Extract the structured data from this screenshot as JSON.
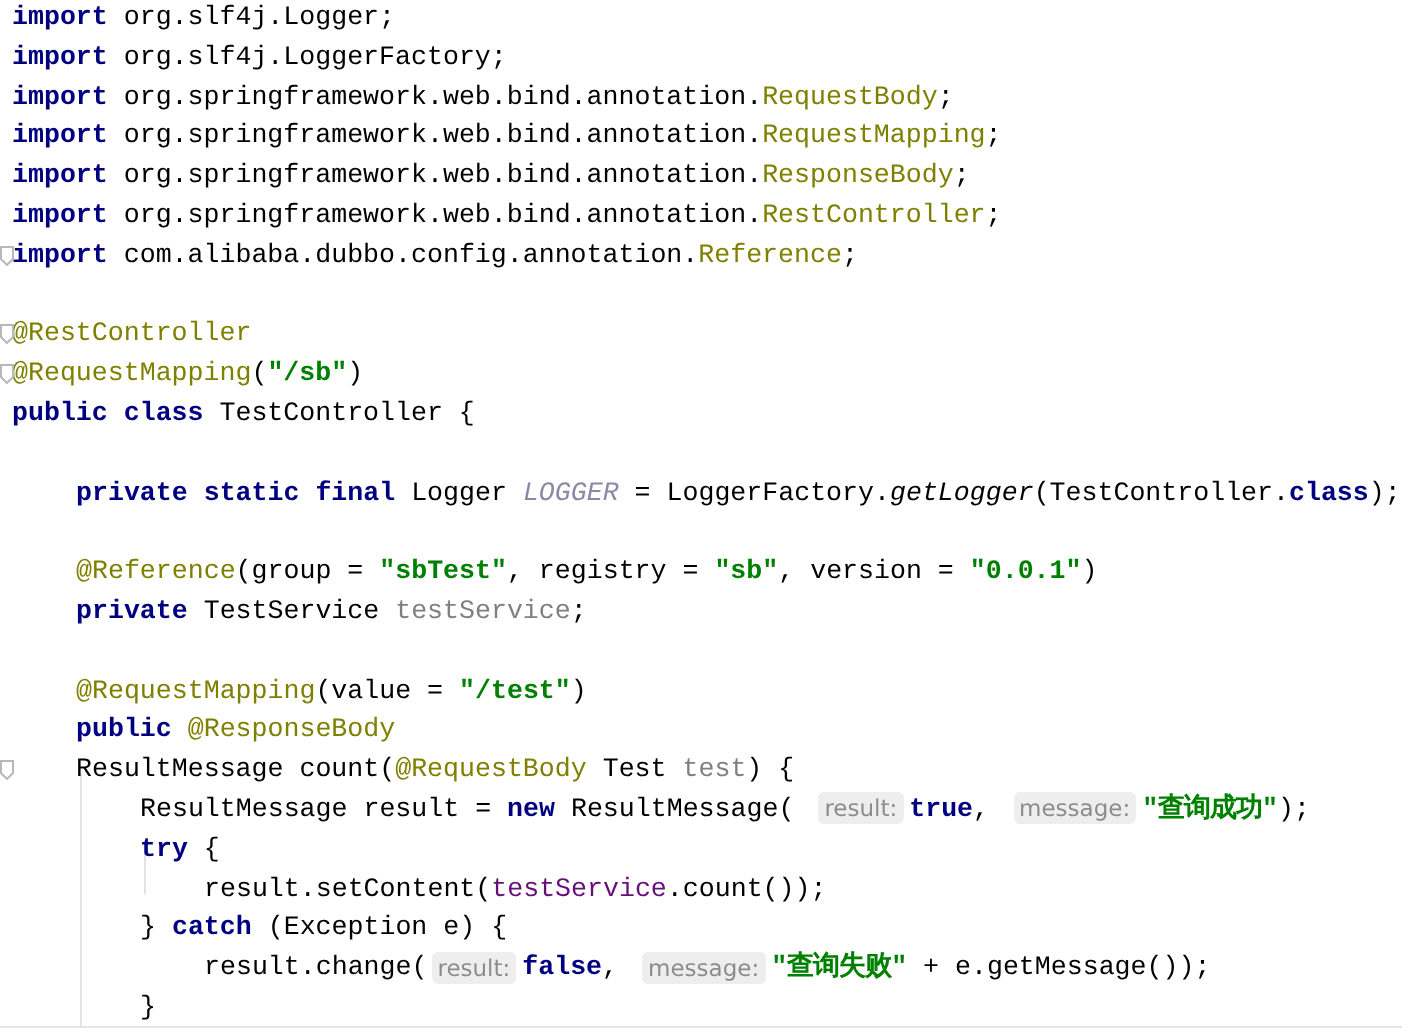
{
  "editor": {
    "lines": [
      {
        "kind": "code",
        "tokens": [
          {
            "kind": "keyword",
            "text": "import"
          },
          {
            "kind": "plain",
            "text": " org.slf4j.Logger;"
          }
        ]
      },
      {
        "kind": "code",
        "tokens": [
          {
            "kind": "keyword",
            "text": "import"
          },
          {
            "kind": "plain",
            "text": " org.slf4j.LoggerFactory;"
          }
        ]
      },
      {
        "kind": "code",
        "tokens": [
          {
            "kind": "keyword",
            "text": "import"
          },
          {
            "kind": "plain",
            "text": " org.springframework.web.bind.annotation."
          },
          {
            "kind": "annotation",
            "text": "RequestBody"
          },
          {
            "kind": "plain",
            "text": ";"
          }
        ]
      },
      {
        "kind": "code",
        "tokens": [
          {
            "kind": "keyword",
            "text": "import"
          },
          {
            "kind": "plain",
            "text": " org.springframework.web.bind.annotation."
          },
          {
            "kind": "annotation",
            "text": "RequestMapping"
          },
          {
            "kind": "plain",
            "text": ";"
          }
        ]
      },
      {
        "kind": "code",
        "tokens": [
          {
            "kind": "keyword",
            "text": "import"
          },
          {
            "kind": "plain",
            "text": " org.springframework.web.bind.annotation."
          },
          {
            "kind": "annotation",
            "text": "ResponseBody"
          },
          {
            "kind": "plain",
            "text": ";"
          }
        ]
      },
      {
        "kind": "code",
        "tokens": [
          {
            "kind": "keyword",
            "text": "import"
          },
          {
            "kind": "plain",
            "text": " org.springframework.web.bind.annotation."
          },
          {
            "kind": "annotation",
            "text": "RestController"
          },
          {
            "kind": "plain",
            "text": ";"
          }
        ]
      },
      {
        "kind": "code",
        "fold": true,
        "tokens": [
          {
            "kind": "keyword",
            "text": "import"
          },
          {
            "kind": "plain",
            "text": " com.alibaba.dubbo.config.annotation."
          },
          {
            "kind": "annotation",
            "text": "Reference"
          },
          {
            "kind": "plain",
            "text": ";"
          }
        ]
      },
      {
        "kind": "blank"
      },
      {
        "kind": "code",
        "fold": true,
        "tokens": [
          {
            "kind": "annotation",
            "text": "@RestController"
          }
        ]
      },
      {
        "kind": "code",
        "fold": true,
        "tokens": [
          {
            "kind": "annotation",
            "text": "@RequestMapping"
          },
          {
            "kind": "plain",
            "text": "("
          },
          {
            "kind": "string",
            "text": "\"/sb\""
          },
          {
            "kind": "plain",
            "text": ")"
          }
        ]
      },
      {
        "kind": "code",
        "tokens": [
          {
            "kind": "keyword",
            "text": "public class"
          },
          {
            "kind": "plain",
            "text": " TestController {"
          }
        ],
        "children": [
          {
            "kind": "blank"
          },
          {
            "kind": "code",
            "tokens": [
              {
                "kind": "keyword",
                "text": "private static final"
              },
              {
                "kind": "plain",
                "text": " Logger "
              },
              {
                "kind": "constant",
                "text": "LOGGER"
              },
              {
                "kind": "plain",
                "text": " = LoggerFactory."
              },
              {
                "kind": "method",
                "text": "getLogger"
              },
              {
                "kind": "plain",
                "text": "(TestController."
              },
              {
                "kind": "keyword",
                "text": "class"
              },
              {
                "kind": "plain",
                "text": ");"
              }
            ]
          },
          {
            "kind": "blank"
          },
          {
            "kind": "code",
            "tokens": [
              {
                "kind": "annotation",
                "text": "@Reference"
              },
              {
                "kind": "plain",
                "text": "(group = "
              },
              {
                "kind": "string",
                "text": "\"sbTest\""
              },
              {
                "kind": "plain",
                "text": ", registry = "
              },
              {
                "kind": "string",
                "text": "\"sb\""
              },
              {
                "kind": "plain",
                "text": ", version = "
              },
              {
                "kind": "string",
                "text": "\"0.0.1\""
              },
              {
                "kind": "plain",
                "text": ")"
              }
            ]
          },
          {
            "kind": "code",
            "tokens": [
              {
                "kind": "keyword",
                "text": "private"
              },
              {
                "kind": "plain",
                "text": " TestService "
              },
              {
                "kind": "unused",
                "text": "testService"
              },
              {
                "kind": "plain",
                "text": ";"
              }
            ]
          },
          {
            "kind": "blank"
          },
          {
            "kind": "code",
            "tokens": [
              {
                "kind": "annotation",
                "text": "@RequestMapping"
              },
              {
                "kind": "plain",
                "text": "(value = "
              },
              {
                "kind": "string",
                "text": "\"/test\""
              },
              {
                "kind": "plain",
                "text": ")"
              }
            ]
          },
          {
            "kind": "code",
            "tokens": [
              {
                "kind": "keyword",
                "text": "public"
              },
              {
                "kind": "annotation",
                "text": " @ResponseBody"
              }
            ]
          },
          {
            "kind": "code",
            "fold": true,
            "tokens": [
              {
                "kind": "plain",
                "text": "ResultMessage count("
              },
              {
                "kind": "annotation",
                "text": "@RequestBody"
              },
              {
                "kind": "plain",
                "text": " Test "
              },
              {
                "kind": "unused",
                "text": "test"
              },
              {
                "kind": "plain",
                "text": ") {"
              }
            ],
            "children": [
              {
                "kind": "code",
                "tokens": [
                  {
                    "kind": "plain",
                    "text": "ResultMessage result = "
                  },
                  {
                    "kind": "keyword",
                    "text": "new"
                  },
                  {
                    "kind": "plain",
                    "text": " ResultMessage("
                  },
                  {
                    "kind": "hint",
                    "text": "result:"
                  },
                  {
                    "kind": "keyword",
                    "text": "true"
                  },
                  {
                    "kind": "plain",
                    "text": ","
                  },
                  {
                    "kind": "hint",
                    "text": "message:"
                  },
                  {
                    "kind": "string",
                    "text": "\"查询成功\""
                  },
                  {
                    "kind": "plain",
                    "text": ");"
                  }
                ]
              },
              {
                "kind": "code",
                "tokens": [
                  {
                    "kind": "keyword",
                    "text": "try"
                  },
                  {
                    "kind": "plain",
                    "text": " {"
                  }
                ],
                "children": [
                  {
                    "kind": "code",
                    "tokens": [
                      {
                        "kind": "plain",
                        "text": "result.setContent("
                      },
                      {
                        "kind": "field",
                        "text": "testService"
                      },
                      {
                        "kind": "plain",
                        "text": ".count());"
                      }
                    ]
                  }
                ]
              },
              {
                "kind": "code",
                "tokens": [
                  {
                    "kind": "plain",
                    "text": "} "
                  },
                  {
                    "kind": "keyword",
                    "text": "catch"
                  },
                  {
                    "kind": "plain",
                    "text": " (Exception e) {"
                  }
                ],
                "children": [
                  {
                    "kind": "code",
                    "tokens": [
                      {
                        "kind": "plain",
                        "text": "result.change("
                      },
                      {
                        "kind": "hint",
                        "text": "result:"
                      },
                      {
                        "kind": "keyword",
                        "text": "false"
                      },
                      {
                        "kind": "plain",
                        "text": ","
                      },
                      {
                        "kind": "hint",
                        "text": "message:"
                      },
                      {
                        "kind": "string",
                        "text": "\"查询失败\""
                      },
                      {
                        "kind": "plain",
                        "text": " + e.getMessage());"
                      }
                    ]
                  }
                ]
              },
              {
                "kind": "code",
                "tokens": [
                  {
                    "kind": "plain",
                    "text": "}"
                  }
                ]
              }
            ]
          }
        ]
      }
    ]
  }
}
